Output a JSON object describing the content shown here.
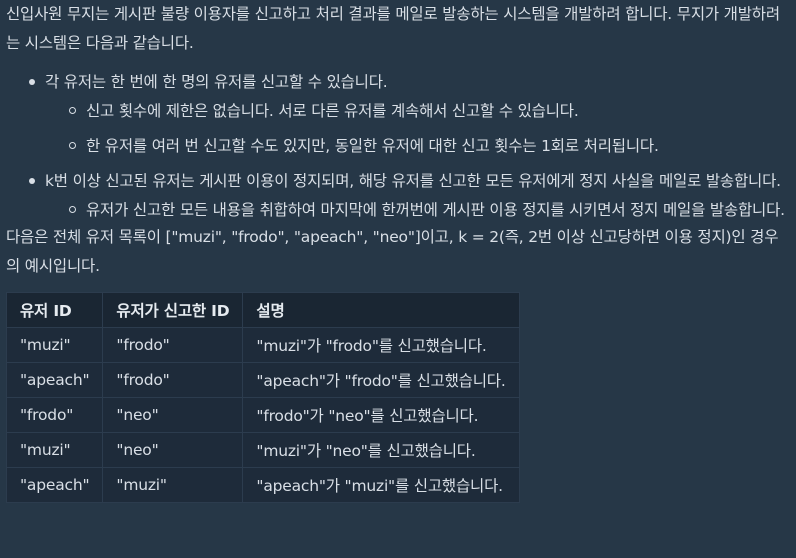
{
  "intro": "신입사원 무지는 게시판 불량 이용자를 신고하고 처리 결과를 메일로 발송하는 시스템을 개발하려 합니다. 무지가 개발하려는 시스템은 다음과 같습니다.",
  "bullets": [
    {
      "text": "각 유저는 한 번에 한 명의 유저를 신고할 수 있습니다.",
      "sub": [
        "신고 횟수에 제한은 없습니다. 서로 다른 유저를 계속해서 신고할 수 있습니다.",
        "한 유저를 여러 번 신고할 수도 있지만, 동일한 유저에 대한 신고 횟수는 1회로 처리됩니다."
      ]
    },
    {
      "text": "k번 이상 신고된 유저는 게시판 이용이 정지되며, 해당 유저를 신고한 모든 유저에게 정지 사실을 메일로 발송합니다.",
      "sub": [
        "유저가 신고한 모든 내용을 취합하여 마지막에 한꺼번에 게시판 이용 정지를 시키면서 정지 메일을 발송합니다."
      ]
    }
  ],
  "example_intro": "다음은 전체 유저 목록이 [\"muzi\", \"frodo\", \"apeach\", \"neo\"]이고, k = 2(즉, 2번 이상 신고당하면 이용 정지)인 경우의 예시입니다.",
  "table": {
    "headers": [
      "유저 ID",
      "유저가 신고한 ID",
      "설명"
    ],
    "rows": [
      [
        "\"muzi\"",
        "\"frodo\"",
        "\"muzi\"가 \"frodo\"를 신고했습니다."
      ],
      [
        "\"apeach\"",
        "\"frodo\"",
        "\"apeach\"가 \"frodo\"를 신고했습니다."
      ],
      [
        "\"frodo\"",
        "\"neo\"",
        "\"frodo\"가 \"neo\"를 신고했습니다."
      ],
      [
        "\"muzi\"",
        "\"neo\"",
        "\"muzi\"가 \"neo\"를 신고했습니다."
      ],
      [
        "\"apeach\"",
        "\"muzi\"",
        "\"apeach\"가 \"muzi\"를 신고했습니다."
      ]
    ]
  }
}
